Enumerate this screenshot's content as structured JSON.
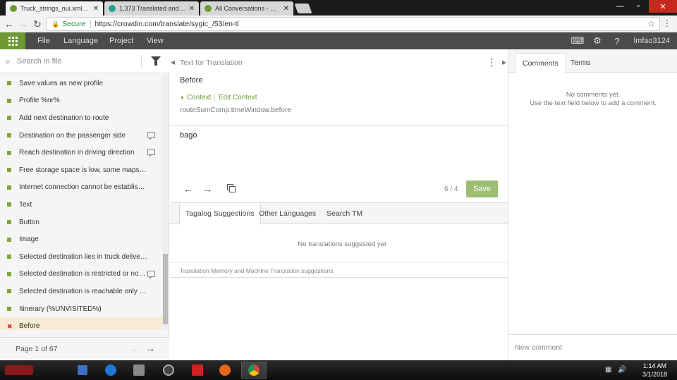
{
  "browser": {
    "tabs": [
      {
        "title": "Truck_strings_nui.xml - S",
        "active": true,
        "color": "#6d9a33"
      },
      {
        "title": "1,373 Translated and Pro",
        "active": false,
        "color": "#2aa08a"
      },
      {
        "title": "All Conversations - Crow",
        "active": false,
        "color": "#6d9a33"
      }
    ],
    "secure_label": "Secure",
    "url": "https://crowdin.com/translate/sygic_/53/en-tl"
  },
  "appbar": {
    "menu": [
      "File",
      "Language",
      "Project",
      "View"
    ],
    "username": "lmfao3124",
    "accent": "#6d9a33"
  },
  "left": {
    "search_placeholder": "Search in file",
    "strings": [
      {
        "text": "Save values as new profile",
        "comment": false,
        "current": false
      },
      {
        "text": "Profile %nr%",
        "comment": false,
        "current": false
      },
      {
        "text": "Add next destination to route",
        "comment": false,
        "current": false
      },
      {
        "text": "Destination on the passenger side",
        "comment": true,
        "current": false
      },
      {
        "text": "Reach destination in driving direction",
        "comment": true,
        "current": false
      },
      {
        "text": "Free storage space is low, some maps will b...",
        "comment": false,
        "current": false
      },
      {
        "text": "Internet connection cannot be established ...",
        "comment": false,
        "current": false
      },
      {
        "text": "Text",
        "comment": false,
        "current": false
      },
      {
        "text": "Button",
        "comment": false,
        "current": false
      },
      {
        "text": "Image",
        "comment": false,
        "current": false
      },
      {
        "text": "Selected destination lies in truck delivery zo...",
        "comment": false,
        "current": false
      },
      {
        "text": "Selected destination is restricted or not ...",
        "comment": true,
        "current": false
      },
      {
        "text": "Selected destination is reachable only durin...",
        "comment": false,
        "current": false
      },
      {
        "text": "Itinerary (%UNVISITED%)",
        "comment": false,
        "current": false
      },
      {
        "text": "Before",
        "comment": false,
        "current": true
      }
    ],
    "page_label": "Page 1 of 67"
  },
  "center": {
    "section_title": "Text for Translation",
    "source_text": "Before",
    "context_label": "Context",
    "edit_context_label": "Edit Context",
    "context_key": "routeSumComp.timeWindow.before",
    "translation_text": "bago",
    "counter": "6 / 4",
    "save_label": "Save",
    "suggestion_tabs": [
      "Tagalog Suggestions",
      "Other Languages",
      "Search TM"
    ],
    "no_suggestions": "No translations suggested yet",
    "tm_label": "Translation Memory and Machine Translation suggestions"
  },
  "right": {
    "tabs": [
      "Comments",
      "Terms"
    ],
    "no_comments_1": "No comments yet.",
    "no_comments_2": "Use the text field below to add a comment.",
    "new_comment_placeholder": "New comment"
  },
  "taskbar": {
    "time": "1:14 AM",
    "date": "3/1/2018"
  }
}
